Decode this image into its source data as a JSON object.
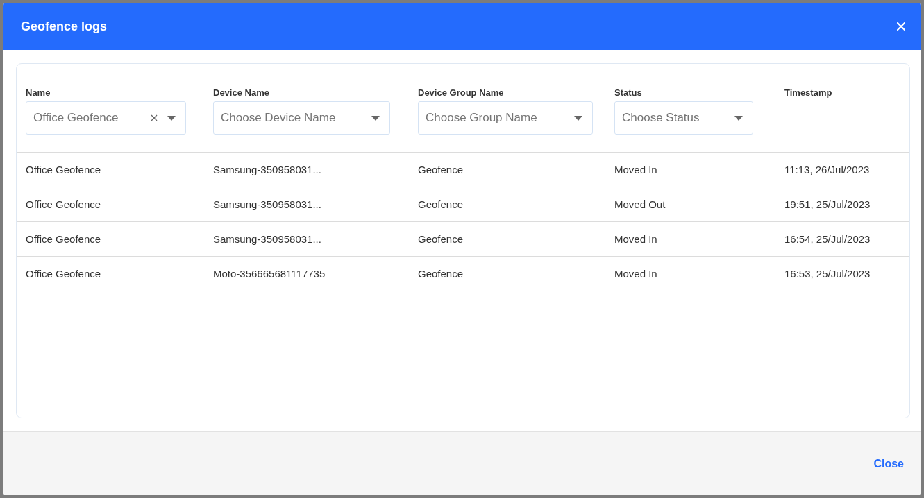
{
  "window": {
    "title": "Geofence logs"
  },
  "columns": [
    {
      "label": "Name",
      "filter": {
        "value": "Office Geofence",
        "clearable": true
      }
    },
    {
      "label": "Device Name",
      "filter": {
        "placeholder": "Choose Device Name"
      }
    },
    {
      "label": "Device Group Name",
      "filter": {
        "placeholder": "Choose Group Name"
      }
    },
    {
      "label": "Status",
      "filter": {
        "placeholder": "Choose Status"
      }
    },
    {
      "label": "Timestamp"
    }
  ],
  "rows": [
    [
      "Office Geofence",
      "Samsung-350958031...",
      "Geofence",
      "Moved In",
      "11:13, 26/Jul/2023"
    ],
    [
      "Office Geofence",
      "Samsung-350958031...",
      "Geofence",
      "Moved Out",
      "19:51, 25/Jul/2023"
    ],
    [
      "Office Geofence",
      "Samsung-350958031...",
      "Geofence",
      "Moved In",
      "16:54, 25/Jul/2023"
    ],
    [
      "Office Geofence",
      "Moto-356665681117735",
      "Geofence",
      "Moved In",
      "16:53, 25/Jul/2023"
    ]
  ],
  "footer": {
    "close_button": "Close"
  }
}
